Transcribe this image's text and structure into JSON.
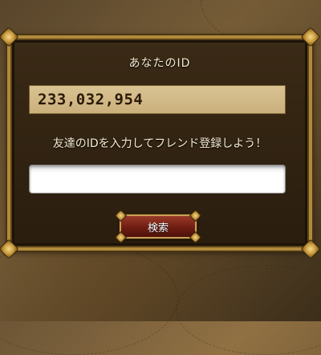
{
  "dialog": {
    "title": "あなたのID",
    "user_id": "233,032,954",
    "instruction": "友達のIDを入力してフレンド登録しよう！",
    "friend_id_input": {
      "value": "",
      "placeholder": ""
    },
    "search_label": "検索"
  },
  "colors": {
    "panel_background": "#2a1d0e",
    "panel_border": "#b08a3c",
    "id_box_background": "#cbb07c",
    "button_red": "#6e1d12",
    "text_light": "#f3ead2"
  }
}
